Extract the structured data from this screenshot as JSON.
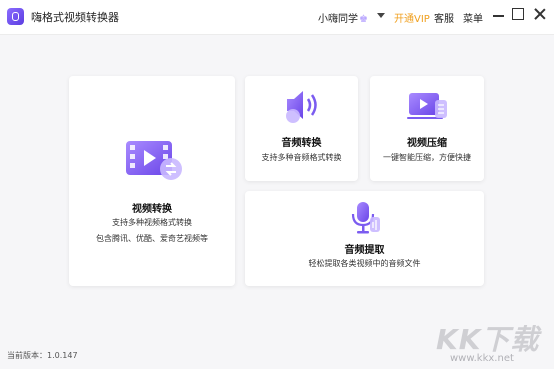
{
  "window": {
    "title": "嗨格式视频转换器",
    "user_name": "小嗨同学",
    "user_badge": "♚",
    "vip_label": "开通VIP",
    "service_label": "客服",
    "menu_label": "菜单"
  },
  "cards": {
    "video": {
      "title": "视频转换",
      "desc1": "支持多种视频格式转换",
      "desc2": "包含腾讯、优酷、爱奇艺视频等"
    },
    "audio": {
      "title": "音频转换",
      "desc": "支持多种音频格式转换"
    },
    "compress": {
      "title": "视频压缩",
      "desc": "一键智能压缩，方便快捷"
    },
    "extract": {
      "title": "音频提取",
      "desc": "轻松提取各类视频中的音频文件"
    }
  },
  "footer": {
    "version": "当前版本：1.0.147"
  },
  "watermark": {
    "logo": "KK下载",
    "url": "www.kkx.net"
  },
  "colors": {
    "accent": "#7b5cf0",
    "vip": "#f0a020"
  }
}
